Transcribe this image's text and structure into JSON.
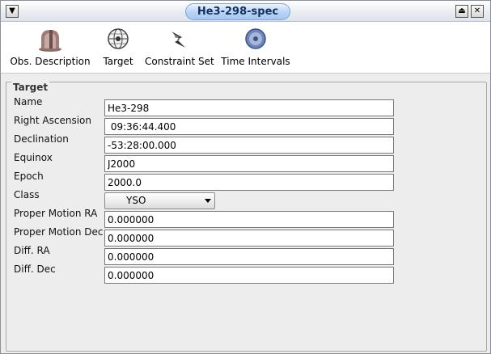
{
  "window": {
    "title": "He3-298-spec"
  },
  "toolbar": {
    "items": [
      {
        "label": "Obs. Description",
        "icon": "telescope-icon"
      },
      {
        "label": "Target",
        "icon": "globe-target-icon"
      },
      {
        "label": "Constraint Set",
        "icon": "constraint-icon"
      },
      {
        "label": "Time Intervals",
        "icon": "clock-disc-icon"
      }
    ]
  },
  "target": {
    "group_title": "Target",
    "name_label": "Name",
    "name_value": "He3-298",
    "ra_label": "Right Ascension",
    "ra_value": " 09:36:44.400",
    "dec_label": "Declination",
    "dec_value": "-53:28:00.000",
    "equinox_label": "Equinox",
    "equinox_value": "J2000",
    "epoch_label": "Epoch",
    "epoch_value": "2000.0",
    "class_label": "Class",
    "class_value": "YSO",
    "pm_ra_label": "Proper Motion RA",
    "pm_ra_value": "0.000000",
    "pm_dec_label": "Proper Motion Dec",
    "pm_dec_value": "0.000000",
    "diff_ra_label": "Diff. RA",
    "diff_ra_value": "0.000000",
    "diff_dec_label": "Diff. Dec",
    "diff_dec_value": "0.000000"
  }
}
